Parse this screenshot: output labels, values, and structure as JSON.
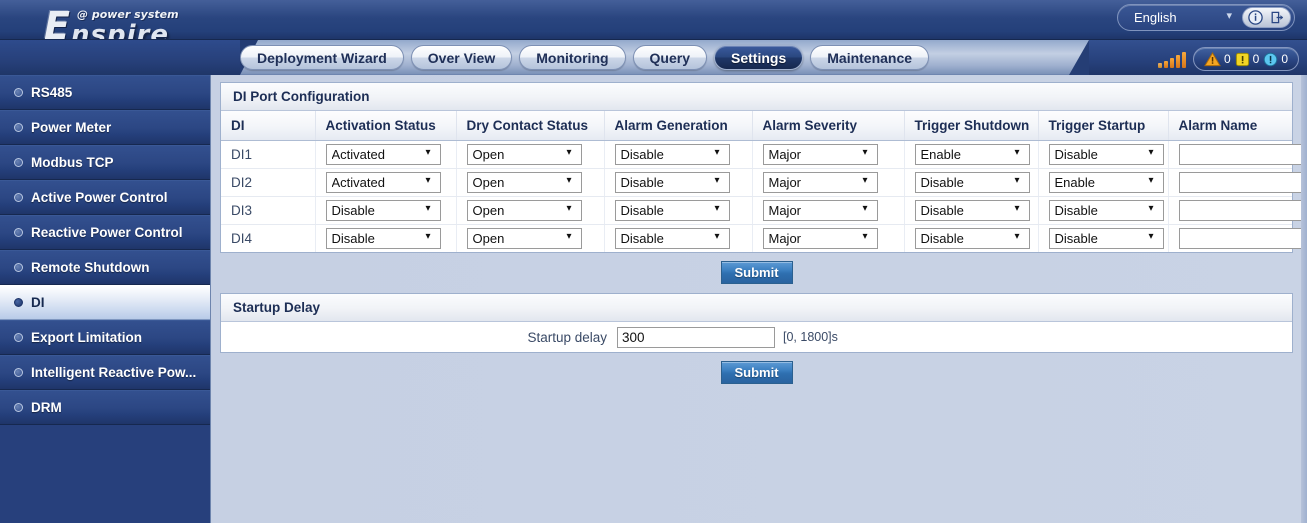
{
  "header": {
    "logo_initial": "E",
    "logo_sub": "@ power system",
    "logo_main": "nspire",
    "language": "English",
    "info_icon": "info-icon",
    "logout_icon": "logout-icon"
  },
  "tabs": [
    {
      "label": "Deployment Wizard",
      "active": false
    },
    {
      "label": "Over View",
      "active": false
    },
    {
      "label": "Monitoring",
      "active": false
    },
    {
      "label": "Query",
      "active": false
    },
    {
      "label": "Settings",
      "active": true
    },
    {
      "label": "Maintenance",
      "active": false
    }
  ],
  "status": {
    "signal_icon": "signal-strength-icon",
    "alarms": [
      {
        "icon": "critical-alarm-icon",
        "count": "0",
        "color": "#f5a623"
      },
      {
        "icon": "major-alarm-icon",
        "count": "0",
        "color": "#f2d525"
      },
      {
        "icon": "minor-alarm-icon",
        "count": "0",
        "color": "#5bc6f0"
      }
    ]
  },
  "sidebar": {
    "items": [
      {
        "label": "RS485",
        "active": false
      },
      {
        "label": "Power Meter",
        "active": false
      },
      {
        "label": "Modbus TCP",
        "active": false
      },
      {
        "label": "Active Power Control",
        "active": false
      },
      {
        "label": "Reactive Power Control",
        "active": false
      },
      {
        "label": "Remote Shutdown",
        "active": false
      },
      {
        "label": "DI",
        "active": true
      },
      {
        "label": "Export Limitation",
        "active": false
      },
      {
        "label": "Intelligent Reactive Pow...",
        "active": false
      },
      {
        "label": "DRM",
        "active": false
      }
    ]
  },
  "di_panel": {
    "title": "DI Port Configuration",
    "columns": [
      "DI",
      "Activation Status",
      "Dry Contact Status",
      "Alarm Generation",
      "Alarm Severity",
      "Trigger Shutdown",
      "Trigger Startup",
      "Alarm Name"
    ],
    "rows": [
      {
        "di": "DI1",
        "activation_status": "Activated",
        "dry_contact_status": "Open",
        "alarm_generation": "Disable",
        "alarm_severity": "Major",
        "trigger_shutdown": "Enable",
        "trigger_startup": "Disable",
        "alarm_name": ""
      },
      {
        "di": "DI2",
        "activation_status": "Activated",
        "dry_contact_status": "Open",
        "alarm_generation": "Disable",
        "alarm_severity": "Major",
        "trigger_shutdown": "Disable",
        "trigger_startup": "Enable",
        "alarm_name": ""
      },
      {
        "di": "DI3",
        "activation_status": "Disable",
        "dry_contact_status": "Open",
        "alarm_generation": "Disable",
        "alarm_severity": "Major",
        "trigger_shutdown": "Disable",
        "trigger_startup": "Disable",
        "alarm_name": ""
      },
      {
        "di": "DI4",
        "activation_status": "Disable",
        "dry_contact_status": "Open",
        "alarm_generation": "Disable",
        "alarm_severity": "Major",
        "trigger_shutdown": "Disable",
        "trigger_startup": "Disable",
        "alarm_name": ""
      }
    ],
    "submit_label": "Submit"
  },
  "startup_delay_panel": {
    "title": "Startup Delay",
    "field_label": "Startup delay",
    "value": "300",
    "hint": "[0, 1800]s",
    "submit_label": "Submit"
  },
  "colors": {
    "brand_navy": "#27407c",
    "accent_blue": "#3b7fc0",
    "content_bg": "#c6d0e3",
    "header_text": "#1d2e55"
  }
}
